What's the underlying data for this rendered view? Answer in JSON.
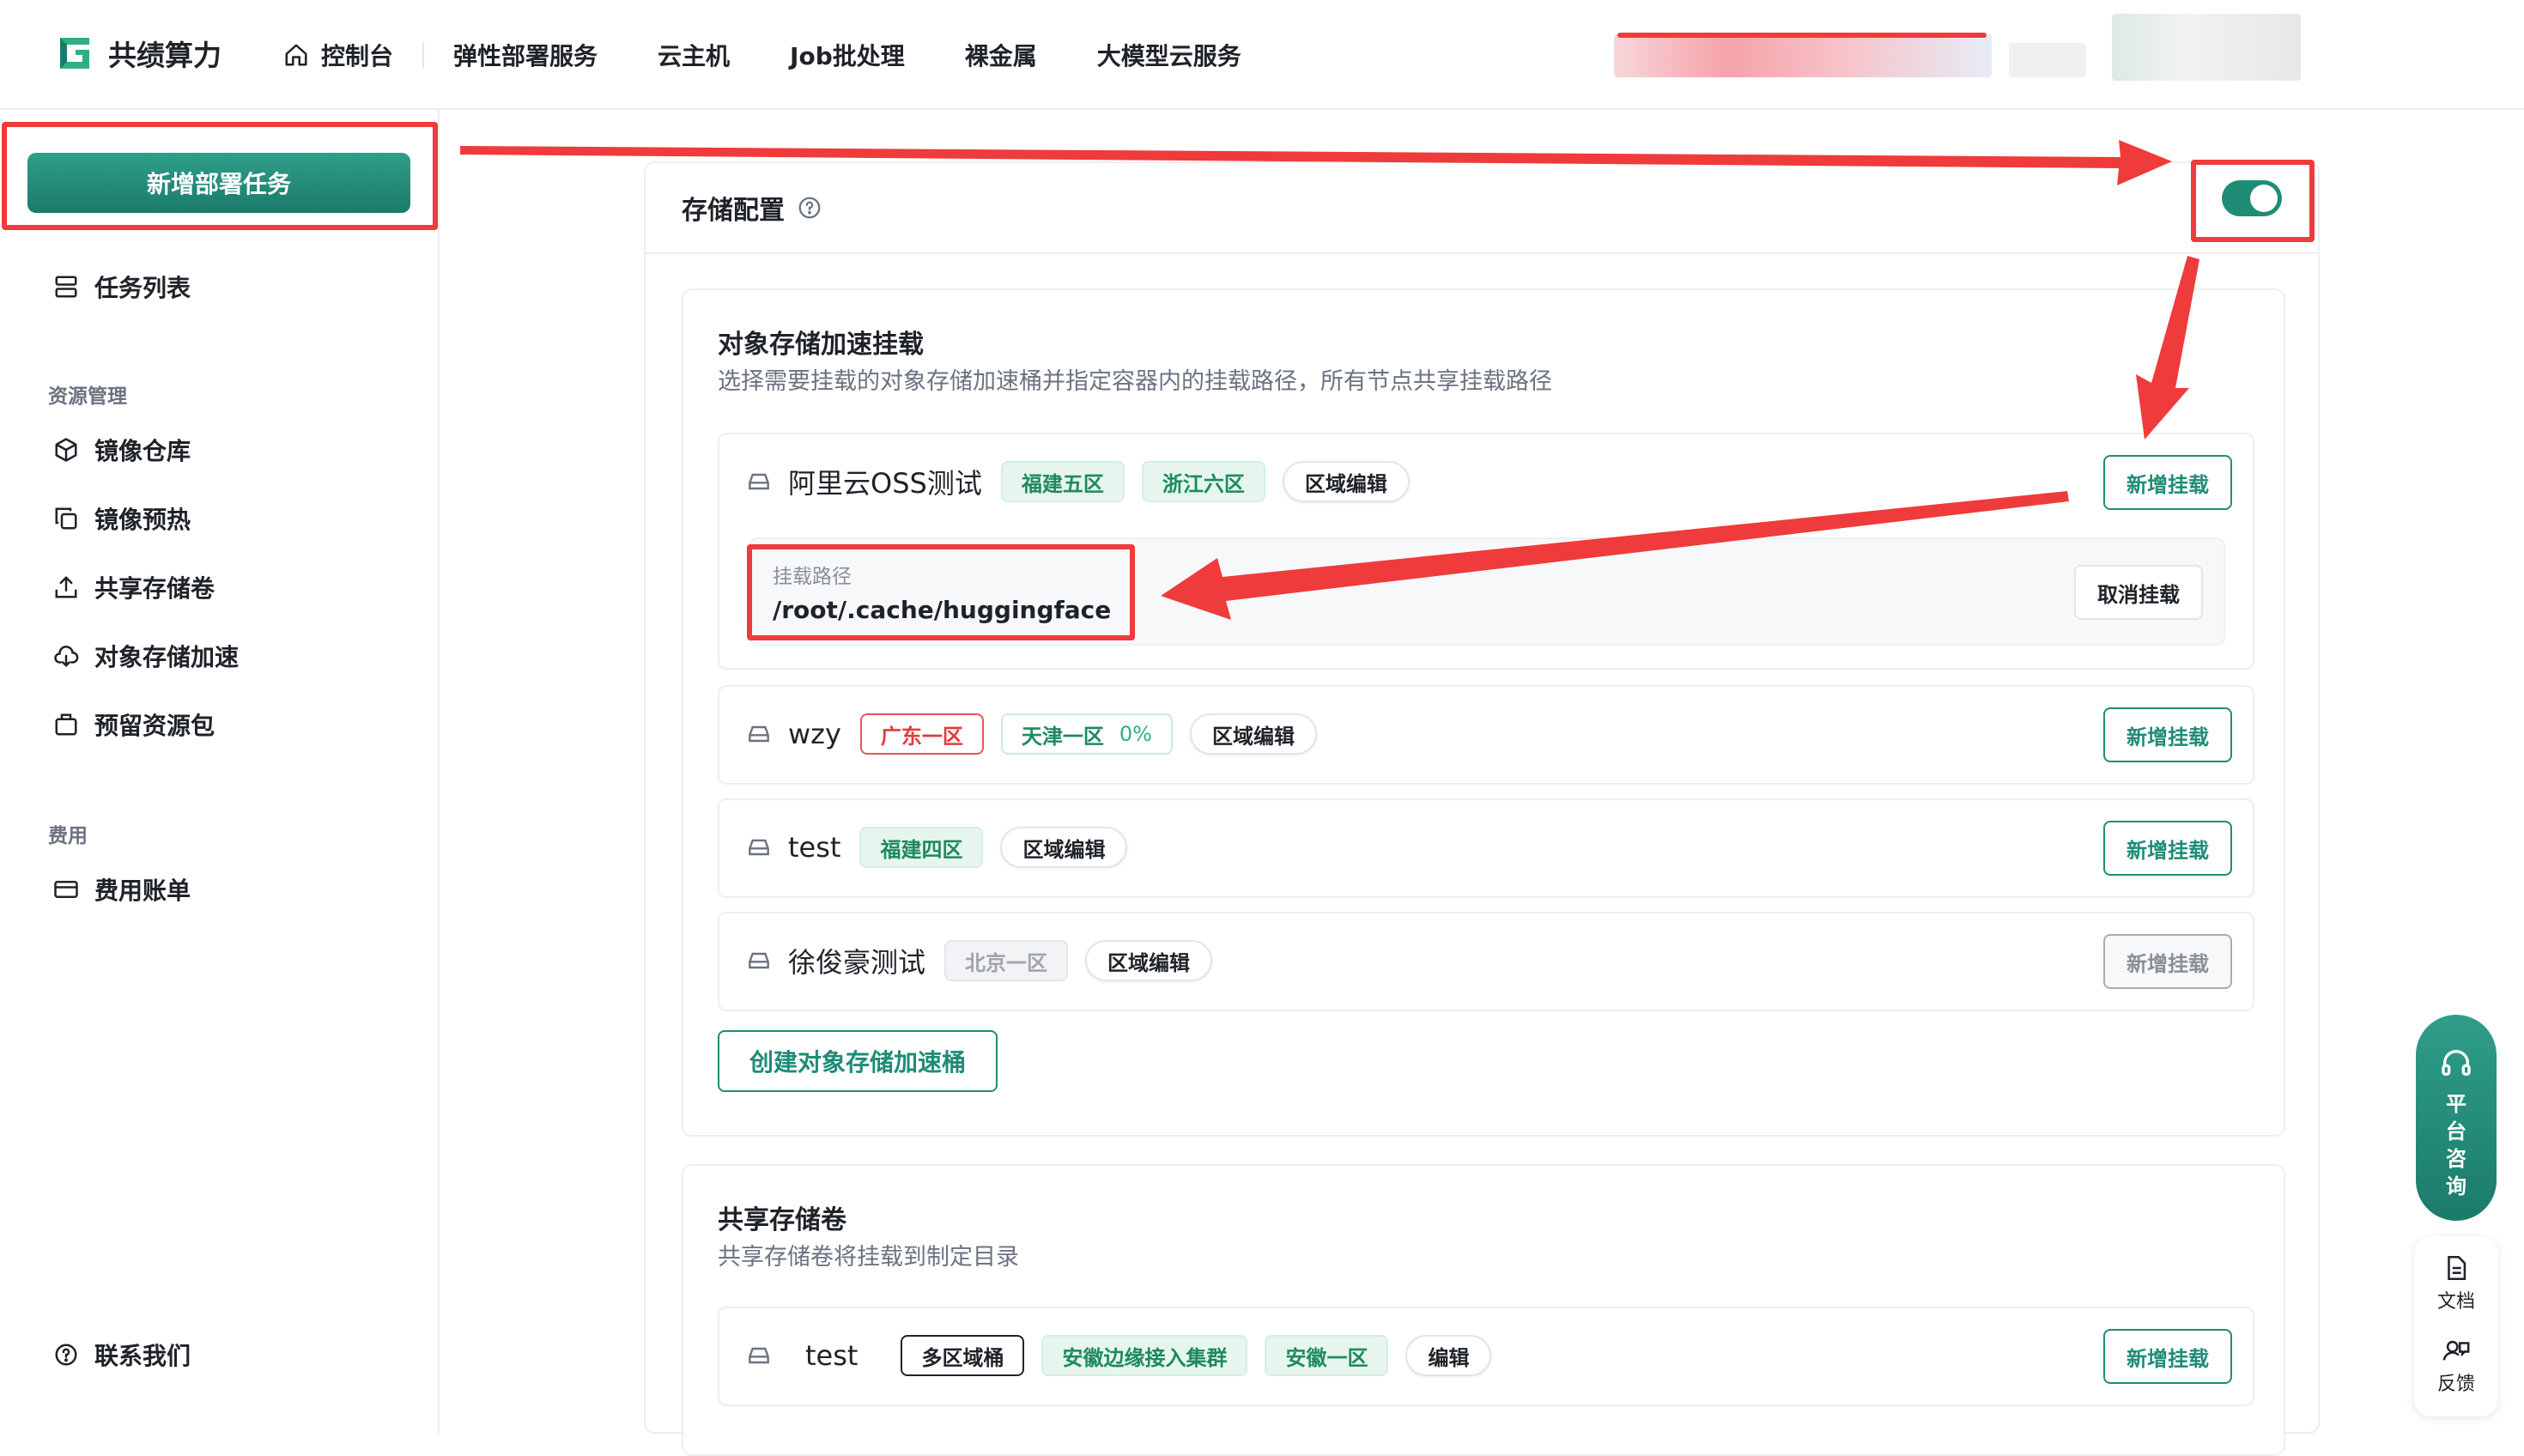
{
  "header": {
    "brand": "共绩算力",
    "nav": [
      {
        "label": "控制台"
      },
      {
        "label": "弹性部署服务"
      },
      {
        "label": "云主机"
      },
      {
        "label": "Job批处理"
      },
      {
        "label": "裸金属"
      },
      {
        "label": "大模型云服务"
      }
    ]
  },
  "sidebar": {
    "new_task": "新增部署任务",
    "task_list": "任务列表",
    "group_resource": "资源管理",
    "items": [
      "镜像仓库",
      "镜像预热",
      "共享存储卷",
      "对象存储加速",
      "预留资源包"
    ],
    "group_fee": "费用",
    "fee_item": "费用账单",
    "contact": "联系我们"
  },
  "storage": {
    "title": "存储配置",
    "enabled": true,
    "object_section": {
      "title": "对象存储加速挂载",
      "desc": "选择需要挂载的对象存储加速桶并指定容器内的挂载路径，所有节点共享挂载路径",
      "buckets": [
        {
          "name": "阿里云OSS测试",
          "tags": [
            "福建五区",
            "浙江六区"
          ],
          "edit": "区域编辑",
          "add": "新增挂载",
          "mount": {
            "label": "挂载路径",
            "value": "/root/.cache/huggingface",
            "cancel": "取消挂载"
          }
        },
        {
          "name": "wzy",
          "tags": [
            "广东一区",
            "天津一区"
          ],
          "tag_percent": "0%",
          "edit": "区域编辑",
          "add": "新增挂载"
        },
        {
          "name": "test",
          "tags": [
            "福建四区"
          ],
          "edit": "区域编辑",
          "add": "新增挂载"
        },
        {
          "name": "徐俊豪测试",
          "tags": [
            "北京一区"
          ],
          "edit": "区域编辑",
          "add": "新增挂载"
        }
      ],
      "create": "创建对象存储加速桶"
    },
    "shared_section": {
      "title": "共享存储卷",
      "desc": "共享存储卷将挂载到制定目录",
      "volumes": [
        {
          "name": "test",
          "tags": [
            "多区域桶",
            "安徽边缘接入集群",
            "安徽一区"
          ],
          "edit": "编辑",
          "add": "新增挂载"
        }
      ]
    }
  },
  "float": {
    "consult": "平台咨询",
    "docs": "文档",
    "feedback": "反馈"
  },
  "colors": {
    "brand": "#1f8c76",
    "annotation": "#ef3b3b"
  }
}
